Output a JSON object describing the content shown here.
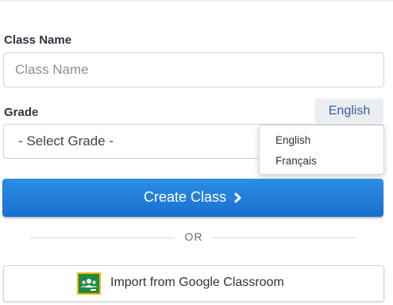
{
  "form": {
    "class_name_label": "Class Name",
    "class_name_placeholder": "Class Name",
    "grade_label": "Grade",
    "grade_select_value": "- Select Grade -",
    "create_button_label": "Create Class",
    "separator_text": "OR",
    "import_button_label": "Import from Google Classroom"
  },
  "language": {
    "current": "English",
    "options": [
      "English",
      "Français"
    ]
  },
  "icons": {
    "create_chevron": "chevron-right-icon",
    "google_classroom": "google-classroom-icon"
  },
  "colors": {
    "primary": "#1f7fdc",
    "link_blue": "#2f5ea3",
    "classroom_green": "#1f8a46",
    "classroom_yellow": "#f5b400"
  }
}
